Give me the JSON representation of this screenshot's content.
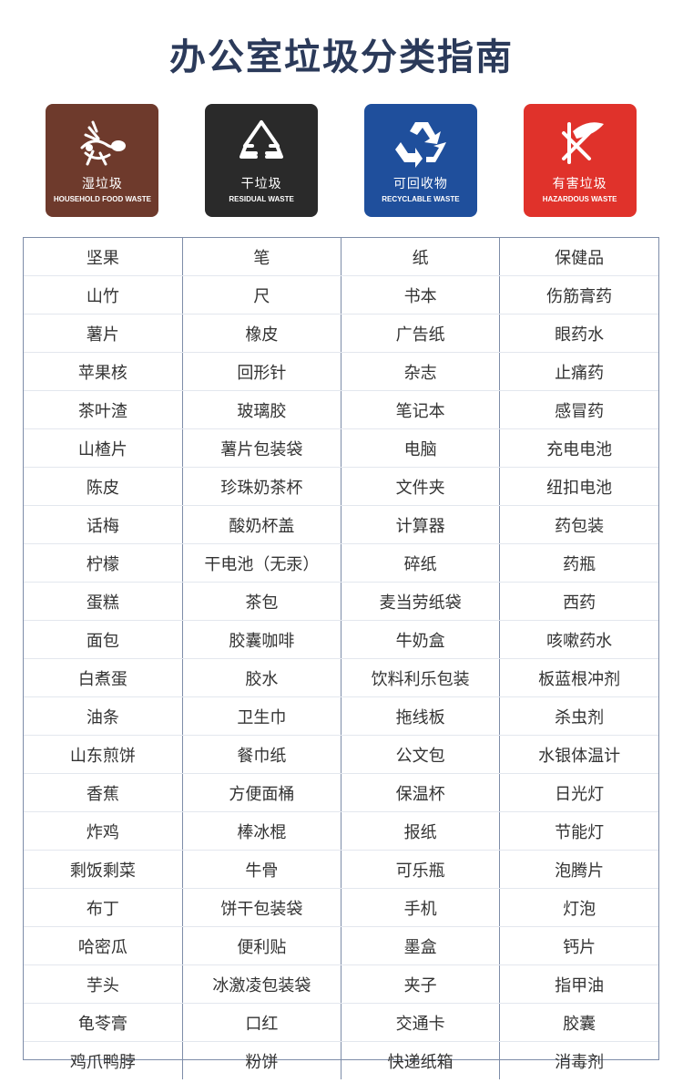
{
  "title": "办公室垃圾分类指南",
  "categories": [
    {
      "cn": "湿垃圾",
      "en": "HOUSEHOLD FOOD WASTE",
      "color": "#6e3a2c",
      "icon": "food-waste-icon"
    },
    {
      "cn": "干垃圾",
      "en": "RESIDUAL WASTE",
      "color": "#2a2a2a",
      "icon": "residual-waste-icon"
    },
    {
      "cn": "可回收物",
      "en": "RECYCLABLE WASTE",
      "color": "#1f4f9c",
      "icon": "recycle-icon"
    },
    {
      "cn": "有害垃圾",
      "en": "HAZARDOUS WASTE",
      "color": "#e0322b",
      "icon": "hazardous-waste-icon"
    }
  ],
  "rows": [
    [
      "坚果",
      "笔",
      "纸",
      "保健品"
    ],
    [
      "山竹",
      "尺",
      "书本",
      "伤筋膏药"
    ],
    [
      "薯片",
      "橡皮",
      "广告纸",
      "眼药水"
    ],
    [
      "苹果核",
      "回形针",
      "杂志",
      "止痛药"
    ],
    [
      "茶叶渣",
      "玻璃胶",
      "笔记本",
      "感冒药"
    ],
    [
      "山楂片",
      "薯片包装袋",
      "电脑",
      "充电电池"
    ],
    [
      "陈皮",
      "珍珠奶茶杯",
      "文件夹",
      "纽扣电池"
    ],
    [
      "话梅",
      "酸奶杯盖",
      "计算器",
      "药包装"
    ],
    [
      "柠檬",
      "干电池（无汞）",
      "碎纸",
      "药瓶"
    ],
    [
      "蛋糕",
      "茶包",
      "麦当劳纸袋",
      "西药"
    ],
    [
      "面包",
      "胶囊咖啡",
      "牛奶盒",
      "咳嗽药水"
    ],
    [
      "白煮蛋",
      "胶水",
      "饮料利乐包装",
      "板蓝根冲剂"
    ],
    [
      "油条",
      "卫生巾",
      "拖线板",
      "杀虫剂"
    ],
    [
      "山东煎饼",
      "餐巾纸",
      "公文包",
      "水银体温计"
    ],
    [
      "香蕉",
      "方便面桶",
      "保温杯",
      "日光灯"
    ],
    [
      "炸鸡",
      "棒冰棍",
      "报纸",
      "节能灯"
    ],
    [
      "剩饭剩菜",
      "牛骨",
      "可乐瓶",
      "泡腾片"
    ],
    [
      "布丁",
      "饼干包装袋",
      "手机",
      "灯泡"
    ],
    [
      "哈密瓜",
      "便利贴",
      "墨盒",
      "钙片"
    ],
    [
      "芋头",
      "冰激凌包装袋",
      "夹子",
      "指甲油"
    ],
    [
      "龟苓膏",
      "口红",
      "交通卡",
      "胶囊"
    ],
    [
      "鸡爪鸭脖",
      "粉饼",
      "快递纸箱",
      "消毒剂"
    ]
  ]
}
